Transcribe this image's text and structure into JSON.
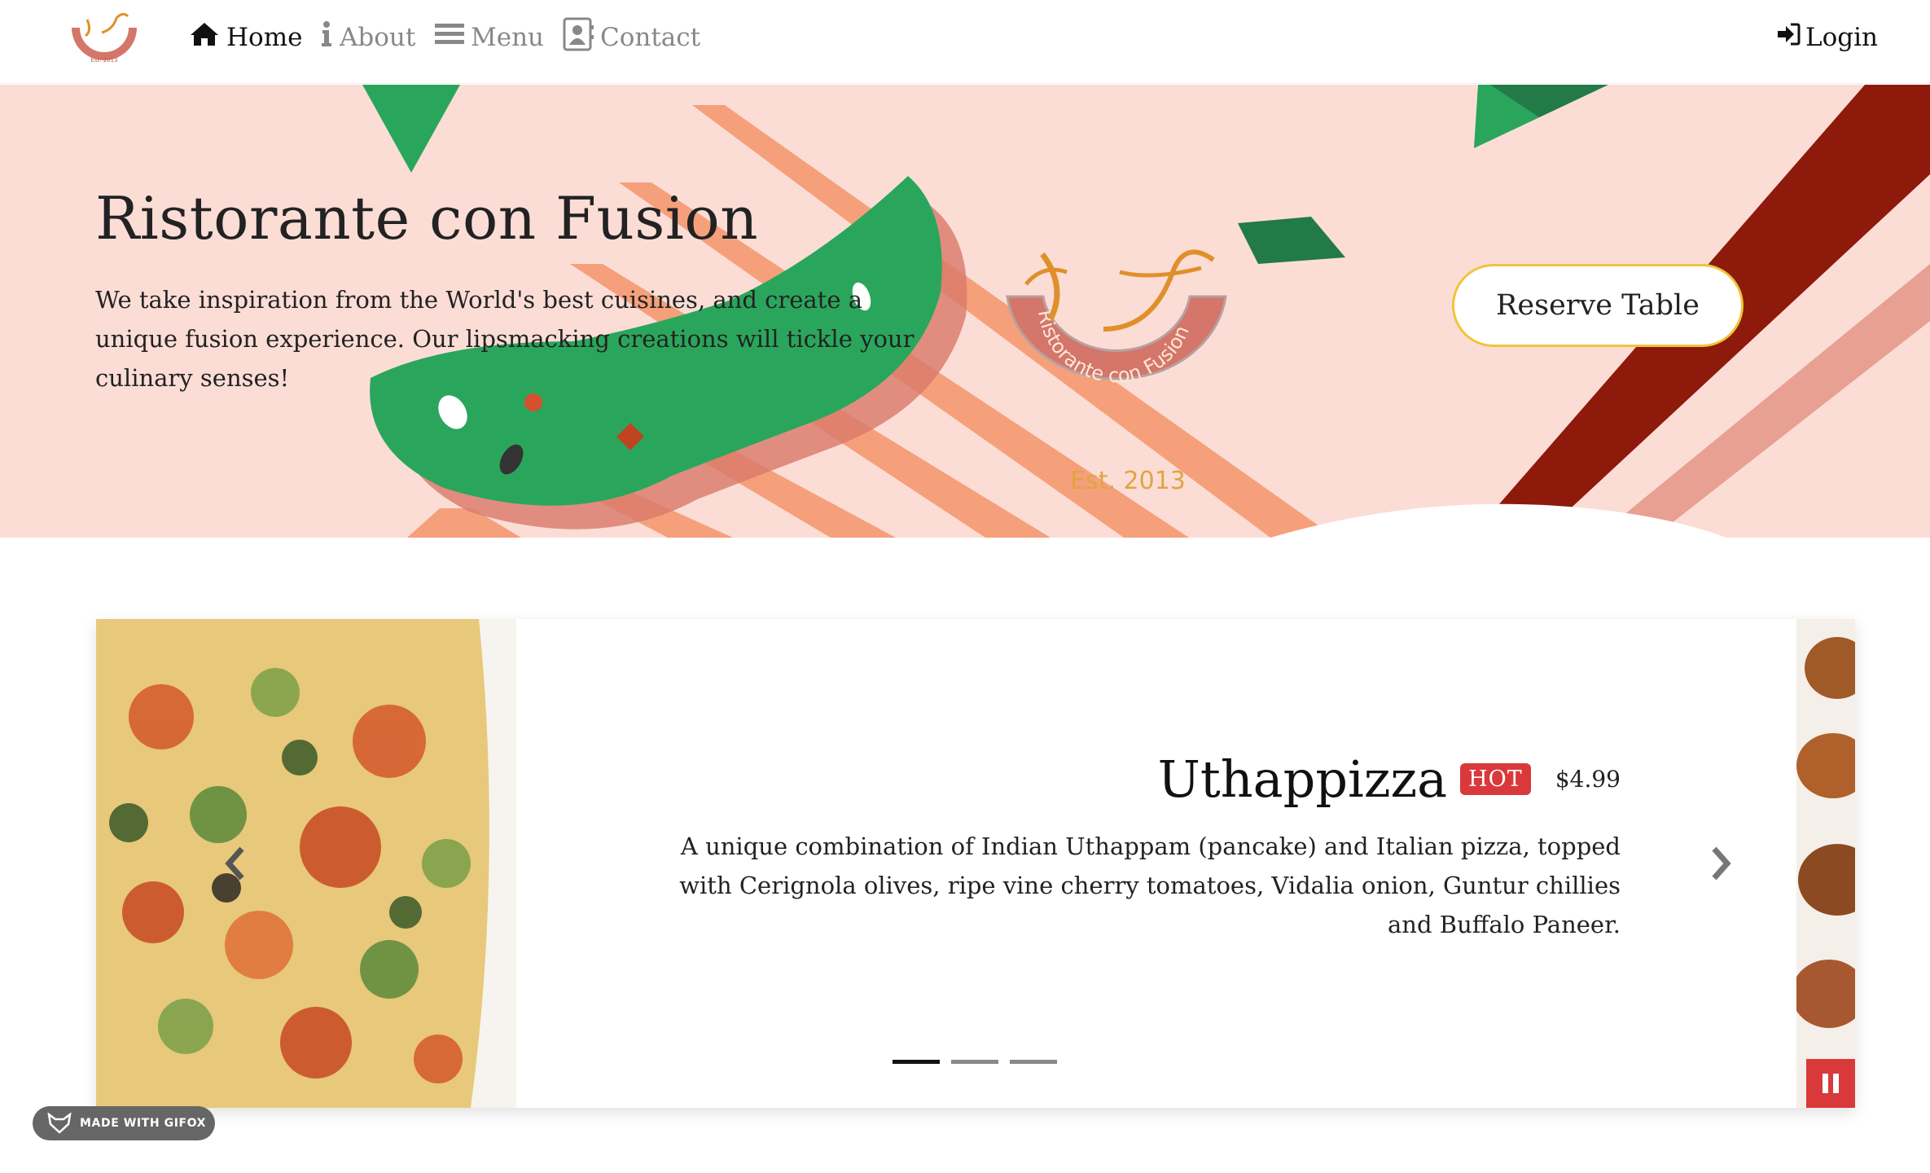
{
  "nav": {
    "logo_text": "Est. 2013",
    "items": [
      {
        "label": "Home",
        "icon": "home-icon",
        "active": true
      },
      {
        "label": "About",
        "icon": "info-icon",
        "active": false
      },
      {
        "label": "Menu",
        "icon": "list-icon",
        "active": false
      },
      {
        "label": "Contact",
        "icon": "address-card-icon",
        "active": false
      }
    ],
    "login_label": "Login",
    "login_icon": "sign-in-icon"
  },
  "hero": {
    "title": "Ristorante con Fusion",
    "text": "We take inspiration from the World's best cuisines, and create a unique fusion experience. Our lipsmacking creations will tickle your culinary senses!",
    "reserve_label": "Reserve Table",
    "logo_arc_text": "Ristorante con Fusion",
    "logo_est": "Est. 2013"
  },
  "carousel": {
    "dish_name": "Uthappizza",
    "badge": "HOT",
    "price": "$4.99",
    "description": "A unique combination of Indian Uthappam (pancake) and Italian pizza, topped with Cerignola olives, ripe vine cherry tomatoes, Vidalia onion, Guntur chillies and Buffalo Paneer.",
    "indicators": 3,
    "active_indicator": 0
  },
  "overlay": {
    "gifox_label": "MADE WITH GIFOX"
  },
  "colors": {
    "hero_bg": "#fbddd6",
    "accent_red": "#d9393b",
    "button_border": "#f0c43a",
    "green": "#2aa65c",
    "orange_stripe": "#f5a07a",
    "dark_red": "#8e1a0c"
  }
}
